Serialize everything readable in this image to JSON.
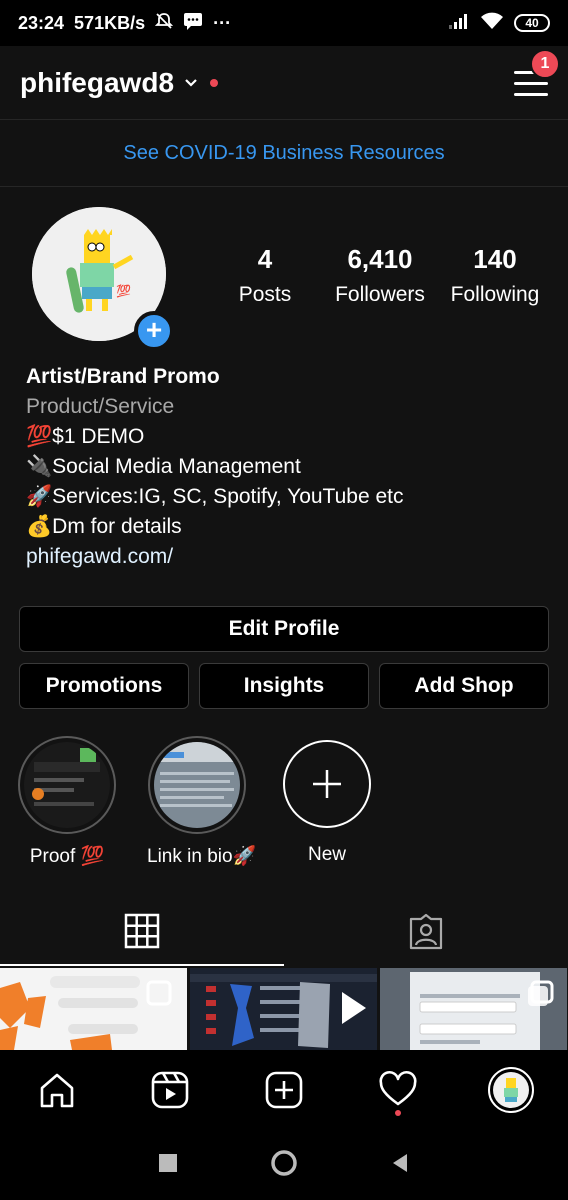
{
  "status_bar": {
    "time": "23:24",
    "speed": "571KB/s",
    "battery": "40",
    "more": "···"
  },
  "header": {
    "username": "phifegawd8",
    "notification_count": "1"
  },
  "banner": {
    "text": "See COVID-19 Business Resources"
  },
  "stats": [
    {
      "value": "4",
      "label": "Posts"
    },
    {
      "value": "6,410",
      "label": "Followers"
    },
    {
      "value": "140",
      "label": "Following"
    }
  ],
  "bio": {
    "name": "Artist/Brand Promo",
    "category": "Product/Service",
    "lines": [
      "💯$1 DEMO",
      "🔌Social Media Management",
      "🚀Services:IG, SC, Spotify, YouTube etc",
      "💰Dm for details"
    ],
    "link": "phifegawd.com/"
  },
  "buttons": {
    "edit_profile": "Edit Profile",
    "promotions": "Promotions",
    "insights": "Insights",
    "add_shop": "Add Shop"
  },
  "highlights": [
    {
      "label": "Proof 💯"
    },
    {
      "label": "Link in bio🚀"
    },
    {
      "label": "New"
    }
  ],
  "colors": {
    "accent": "#3897f0",
    "badge": "#ed4956",
    "background": "#121212"
  }
}
